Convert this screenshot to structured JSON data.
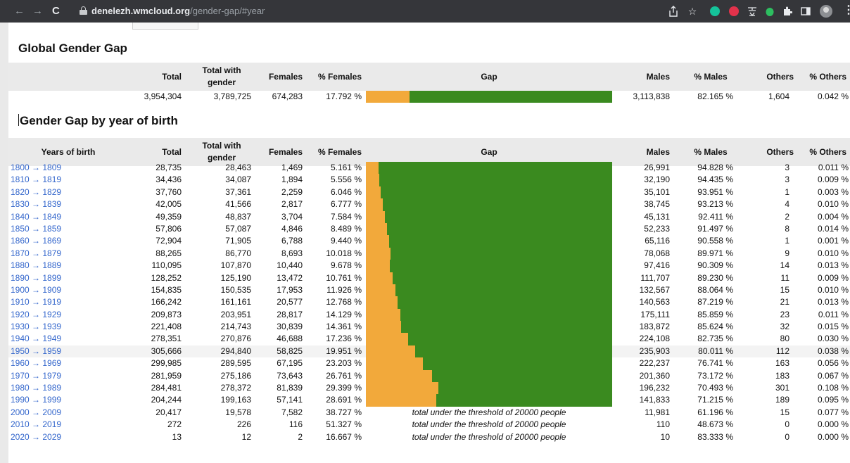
{
  "browser": {
    "back_icon": "←",
    "forward_icon": "→",
    "reload_icon": "C",
    "url_domain": "denelezh.wmcloud.org",
    "url_path": "/gender-gap/#year",
    "more_icon": "⋮"
  },
  "colors": {
    "female": "#f2a93b",
    "male": "#3a8a1f",
    "link": "#3366cc"
  },
  "global": {
    "title": "Global Gender Gap",
    "headers": {
      "total": "Total",
      "total_with_gender": "Total with gender",
      "females": "Females",
      "pct_females": "% Females",
      "gap": "Gap",
      "males": "Males",
      "pct_males": "% Males",
      "others": "Others",
      "pct_others": "% Others"
    },
    "row": {
      "total": "3,954,304",
      "total_with_gender": "3,789,725",
      "females": "674,283",
      "pct_females": "17.792 %",
      "female_share": 17.792,
      "males": "3,113,838",
      "pct_males": "82.165 %",
      "others": "1,604",
      "pct_others": "0.042 %"
    }
  },
  "by_year": {
    "title": "Gender Gap by year of birth",
    "headers": {
      "years": "Years of birth",
      "total": "Total",
      "total_with_gender": "Total with gender",
      "females": "Females",
      "pct_females": "% Females",
      "gap": "Gap",
      "males": "Males",
      "pct_males": "% Males",
      "others": "Others",
      "pct_others": "% Others"
    },
    "rows": [
      {
        "years": "1800 → 1809",
        "total": "28,735",
        "twg": "28,463",
        "females": "1,469",
        "pctf": "5.161 %",
        "share": 5.161,
        "males": "26,991",
        "pctm": "94.828 %",
        "others": "3",
        "pcto": "0.011 %"
      },
      {
        "years": "1810 → 1819",
        "total": "34,436",
        "twg": "34,087",
        "females": "1,894",
        "pctf": "5.556 %",
        "share": 5.556,
        "males": "32,190",
        "pctm": "94.435 %",
        "others": "3",
        "pcto": "0.009 %"
      },
      {
        "years": "1820 → 1829",
        "total": "37,760",
        "twg": "37,361",
        "females": "2,259",
        "pctf": "6.046 %",
        "share": 6.046,
        "males": "35,101",
        "pctm": "93.951 %",
        "others": "1",
        "pcto": "0.003 %"
      },
      {
        "years": "1830 → 1839",
        "total": "42,005",
        "twg": "41,566",
        "females": "2,817",
        "pctf": "6.777 %",
        "share": 6.777,
        "males": "38,745",
        "pctm": "93.213 %",
        "others": "4",
        "pcto": "0.010 %"
      },
      {
        "years": "1840 → 1849",
        "total": "49,359",
        "twg": "48,837",
        "females": "3,704",
        "pctf": "7.584 %",
        "share": 7.584,
        "males": "45,131",
        "pctm": "92.411 %",
        "others": "2",
        "pcto": "0.004 %"
      },
      {
        "years": "1850 → 1859",
        "total": "57,806",
        "twg": "57,087",
        "females": "4,846",
        "pctf": "8.489 %",
        "share": 8.489,
        "males": "52,233",
        "pctm": "91.497 %",
        "others": "8",
        "pcto": "0.014 %"
      },
      {
        "years": "1860 → 1869",
        "total": "72,904",
        "twg": "71,905",
        "females": "6,788",
        "pctf": "9.440 %",
        "share": 9.44,
        "males": "65,116",
        "pctm": "90.558 %",
        "others": "1",
        "pcto": "0.001 %"
      },
      {
        "years": "1870 → 1879",
        "total": "88,265",
        "twg": "86,770",
        "females": "8,693",
        "pctf": "10.018 %",
        "share": 10.018,
        "males": "78,068",
        "pctm": "89.971 %",
        "others": "9",
        "pcto": "0.010 %"
      },
      {
        "years": "1880 → 1889",
        "total": "110,095",
        "twg": "107,870",
        "females": "10,440",
        "pctf": "9.678 %",
        "share": 9.678,
        "males": "97,416",
        "pctm": "90.309 %",
        "others": "14",
        "pcto": "0.013 %"
      },
      {
        "years": "1890 → 1899",
        "total": "128,252",
        "twg": "125,190",
        "females": "13,472",
        "pctf": "10.761 %",
        "share": 10.761,
        "males": "111,707",
        "pctm": "89.230 %",
        "others": "11",
        "pcto": "0.009 %"
      },
      {
        "years": "1900 → 1909",
        "total": "154,835",
        "twg": "150,535",
        "females": "17,953",
        "pctf": "11.926 %",
        "share": 11.926,
        "males": "132,567",
        "pctm": "88.064 %",
        "others": "15",
        "pcto": "0.010 %"
      },
      {
        "years": "1910 → 1919",
        "total": "166,242",
        "twg": "161,161",
        "females": "20,577",
        "pctf": "12.768 %",
        "share": 12.768,
        "males": "140,563",
        "pctm": "87.219 %",
        "others": "21",
        "pcto": "0.013 %"
      },
      {
        "years": "1920 → 1929",
        "total": "209,873",
        "twg": "203,951",
        "females": "28,817",
        "pctf": "14.129 %",
        "share": 14.129,
        "males": "175,111",
        "pctm": "85.859 %",
        "others": "23",
        "pcto": "0.011 %"
      },
      {
        "years": "1930 → 1939",
        "total": "221,408",
        "twg": "214,743",
        "females": "30,839",
        "pctf": "14.361 %",
        "share": 14.361,
        "males": "183,872",
        "pctm": "85.624 %",
        "others": "32",
        "pcto": "0.015 %"
      },
      {
        "years": "1940 → 1949",
        "total": "278,351",
        "twg": "270,876",
        "females": "46,688",
        "pctf": "17.236 %",
        "share": 17.236,
        "males": "224,108",
        "pctm": "82.735 %",
        "others": "80",
        "pcto": "0.030 %"
      },
      {
        "years": "1950 → 1959",
        "total": "305,666",
        "twg": "294,840",
        "females": "58,825",
        "pctf": "19.951 %",
        "share": 19.951,
        "males": "235,903",
        "pctm": "80.011 %",
        "others": "112",
        "pcto": "0.038 %",
        "highlight": true
      },
      {
        "years": "1960 → 1969",
        "total": "299,985",
        "twg": "289,595",
        "females": "67,195",
        "pctf": "23.203 %",
        "share": 23.203,
        "males": "222,237",
        "pctm": "76.741 %",
        "others": "163",
        "pcto": "0.056 %"
      },
      {
        "years": "1970 → 1979",
        "total": "281,959",
        "twg": "275,186",
        "females": "73,643",
        "pctf": "26.761 %",
        "share": 26.761,
        "males": "201,360",
        "pctm": "73.172 %",
        "others": "183",
        "pcto": "0.067 %"
      },
      {
        "years": "1980 → 1989",
        "total": "284,481",
        "twg": "278,372",
        "females": "81,839",
        "pctf": "29.399 %",
        "share": 29.399,
        "males": "196,232",
        "pctm": "70.493 %",
        "others": "301",
        "pcto": "0.108 %"
      },
      {
        "years": "1990 → 1999",
        "total": "204,244",
        "twg": "199,163",
        "females": "57,141",
        "pctf": "28.691 %",
        "share": 28.691,
        "males": "141,833",
        "pctm": "71.215 %",
        "others": "189",
        "pcto": "0.095 %"
      },
      {
        "years": "2000 → 2009",
        "total": "20,417",
        "twg": "19,578",
        "females": "7,582",
        "pctf": "38.727 %",
        "note": "total under the threshold of 20000 people",
        "males": "11,981",
        "pctm": "61.196 %",
        "others": "15",
        "pcto": "0.077 %"
      },
      {
        "years": "2010 → 2019",
        "total": "272",
        "twg": "226",
        "females": "116",
        "pctf": "51.327 %",
        "note": "total under the threshold of 20000 people",
        "males": "110",
        "pctm": "48.673 %",
        "others": "0",
        "pcto": "0.000 %"
      },
      {
        "years": "2020 → 2029",
        "total": "13",
        "twg": "12",
        "females": "2",
        "pctf": "16.667 %",
        "note": "total under the threshold of 20000 people",
        "males": "10",
        "pctm": "83.333 %",
        "others": "0",
        "pcto": "0.000 %"
      }
    ]
  }
}
